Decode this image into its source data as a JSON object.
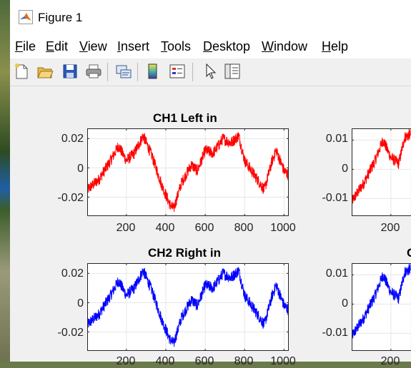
{
  "window": {
    "title": "Figure 1",
    "icon": "matlab-logo-icon"
  },
  "menu": [
    {
      "label": "File"
    },
    {
      "label": "Edit"
    },
    {
      "label": "View"
    },
    {
      "label": "Insert"
    },
    {
      "label": "Tools"
    },
    {
      "label": "Desktop"
    },
    {
      "label": "Window"
    },
    {
      "label": "Help"
    }
  ],
  "toolbar": {
    "icons": [
      "new-figure-icon",
      "open-file-icon",
      "save-icon",
      "print-icon",
      "link-plot-icon",
      "insert-colorbar-icon",
      "insert-legend-icon",
      "pointer-icon",
      "property-inspector-icon"
    ]
  },
  "colors": {
    "ch1": "#ff0000",
    "ch2": "#0000ff"
  },
  "chart_data": [
    {
      "type": "line",
      "title": "CH1 Left in",
      "series_color": "#ff0000",
      "xlim": [
        1,
        1024
      ],
      "ylim": [
        -0.033,
        0.027
      ],
      "xticks": [
        200,
        400,
        600,
        800,
        1000
      ],
      "yticks": [
        0.02,
        0,
        -0.02
      ],
      "xtick_labels": [
        "200",
        "400",
        "600",
        "800",
        "1000"
      ],
      "ytick_labels": [
        "0.02",
        "0",
        "-0.02"
      ],
      "grid": true,
      "trend": {
        "x": [
          1,
          60,
          120,
          160,
          200,
          240,
          285,
          330,
          380,
          420,
          440,
          480,
          530,
          560,
          600,
          640,
          690,
          730,
          770,
          800,
          860,
          900,
          940,
          960,
          1000,
          1024
        ],
        "y": [
          -0.015,
          -0.008,
          0.005,
          0.015,
          0.005,
          0.01,
          0.022,
          0.008,
          -0.012,
          -0.025,
          -0.028,
          -0.01,
          0.002,
          -0.002,
          0.012,
          0.01,
          0.02,
          0.017,
          0.022,
          0.005,
          -0.007,
          -0.015,
          0.005,
          0.012,
          -0.002,
          -0.005
        ]
      },
      "noise_amplitude": 0.004
    },
    {
      "type": "line",
      "title": "",
      "series_color": "#ff0000",
      "xlim": [
        1,
        1024
      ],
      "ylim": [
        -0.016,
        0.014
      ],
      "xticks": [
        200
      ],
      "yticks": [
        0.01,
        0,
        -0.01
      ],
      "xtick_labels": [
        "200"
      ],
      "ytick_labels": [
        "0.01",
        "0",
        "-0.01"
      ],
      "grid": true,
      "trend": {
        "x": [
          1,
          60,
          120,
          160,
          200,
          240,
          270,
          300
        ],
        "y": [
          -0.011,
          -0.005,
          0.003,
          0.01,
          0.004,
          0.002,
          0.011,
          0.012
        ]
      },
      "noise_amplitude": 0.002
    },
    {
      "type": "line",
      "title": "CH2 Right in",
      "series_color": "#0000ff",
      "xlim": [
        1,
        1024
      ],
      "ylim": [
        -0.033,
        0.027
      ],
      "xticks": [
        200,
        400,
        600,
        800,
        1000
      ],
      "yticks": [
        0.02,
        0,
        -0.02
      ],
      "xtick_labels": [
        "200",
        "400",
        "600",
        "800",
        "1000"
      ],
      "ytick_labels": [
        "0.02",
        "0",
        "-0.02"
      ],
      "grid": true,
      "trend": {
        "x": [
          1,
          60,
          120,
          160,
          200,
          240,
          285,
          330,
          380,
          420,
          440,
          480,
          530,
          560,
          600,
          640,
          690,
          730,
          770,
          800,
          860,
          900,
          940,
          960,
          1000,
          1024
        ],
        "y": [
          -0.015,
          -0.008,
          0.005,
          0.015,
          0.005,
          0.01,
          0.022,
          0.008,
          -0.012,
          -0.025,
          -0.028,
          -0.01,
          0.002,
          -0.002,
          0.012,
          0.01,
          0.02,
          0.017,
          0.022,
          0.005,
          -0.007,
          -0.015,
          0.005,
          0.012,
          -0.002,
          -0.005
        ]
      },
      "noise_amplitude": 0.004
    },
    {
      "type": "line",
      "title": "C",
      "series_color": "#0000ff",
      "xlim": [
        1,
        1024
      ],
      "ylim": [
        -0.016,
        0.014
      ],
      "xticks": [
        200
      ],
      "yticks": [
        0.01,
        0,
        -0.01
      ],
      "xtick_labels": [
        "200"
      ],
      "ytick_labels": [
        "0.01",
        "0",
        "-0.01"
      ],
      "grid": true,
      "trend": {
        "x": [
          1,
          60,
          120,
          160,
          200,
          240,
          270,
          300
        ],
        "y": [
          -0.011,
          -0.005,
          0.003,
          0.01,
          0.004,
          0.002,
          0.011,
          0.012
        ]
      },
      "noise_amplitude": 0.002
    }
  ]
}
